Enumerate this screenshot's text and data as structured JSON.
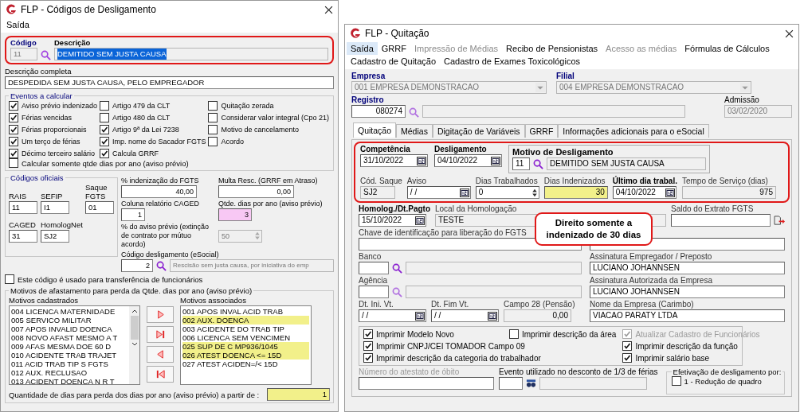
{
  "left_window": {
    "title": "FLP - Códigos de Desligamento",
    "menu": [
      {
        "label": "Saída"
      }
    ],
    "codigo": {
      "label": "Código",
      "value": "11"
    },
    "descricao": {
      "label": "Descrição",
      "value": "DEMITIDO SEM JUSTA CAUSA",
      "selected": true
    },
    "descricao_completa": {
      "label": "Descrição completa",
      "value": "DESPEDIDA SEM JUSTA CAUSA, PELO EMPREGADOR"
    },
    "eventos": {
      "title": "Eventos a calcular",
      "columns": [
        [
          {
            "label": "Aviso prévio indenizado",
            "checked": true
          },
          {
            "label": "Férias vencidas",
            "checked": true
          },
          {
            "label": "Férias proporcionais",
            "checked": true
          },
          {
            "label": "Um terço de férias",
            "checked": true
          },
          {
            "label": "Décimo terceiro salário",
            "checked": true
          }
        ],
        [
          {
            "label": "Artigo 479 da CLT",
            "checked": false
          },
          {
            "label": "Artigo 480 da CLT",
            "checked": false
          },
          {
            "label": "Artigo 9ª da Lei 7238",
            "checked": true
          },
          {
            "label": "Imp. nome do Sacador FGTS",
            "checked": true
          },
          {
            "label": "Calcula GRRF",
            "checked": true
          }
        ],
        [
          {
            "label": "Quitação zerada",
            "checked": false
          },
          {
            "label": "Considerar valor integral (Cpo 21)",
            "checked": false
          },
          {
            "label": "Motivo de cancelamento",
            "checked": false
          },
          {
            "label": "Acordo",
            "checked": false
          }
        ]
      ],
      "last": {
        "label": "Calcular somente qtde dias por ano (aviso prévio)",
        "checked": false
      }
    },
    "codigos_oficiais": {
      "title": "Códigos oficiais",
      "fields": [
        {
          "label": "RAIS",
          "value": "11"
        },
        {
          "label": "SEFIP",
          "value": "I1"
        },
        {
          "label": "Saque FGTS",
          "value": "01"
        },
        {
          "label": "CAGED",
          "value": "31"
        },
        {
          "label": "HomologNet",
          "value": "SJ2"
        }
      ]
    },
    "indenizacao_fgts": {
      "label": "% indenização do FGTS",
      "value": "40,00"
    },
    "multa_resc": {
      "label": "Multa Resc. (GRRF em Atraso)",
      "value": "0,00"
    },
    "coluna_caged": {
      "label": "Coluna relatório CAGED",
      "value": "1"
    },
    "qtde_dias": {
      "label": "Qtde. dias por ano (aviso prévio)",
      "value": "3",
      "highlighted": true
    },
    "aviso_previo_pct": {
      "label": "% do aviso prévio (extinção de contrato por mútuo acordo)",
      "value": "50",
      "disabled": true
    },
    "codigo_esocial": {
      "label": "Código desligamento (eSocial)",
      "value": "2",
      "description": "Rescisão sem justa causa, por iniciativa do emp"
    },
    "transferencia": {
      "label": "Este código é usado para transferência de funcionários",
      "checked": false
    },
    "motivos": {
      "title": "Motivos de afastamento para perda da Qtde. dias por ano (aviso prévio)",
      "cadastrados": {
        "label": "Motivos cadastrados",
        "items": [
          "004 LICENCA MATERNIDADE",
          "005 SERVICO MILITAR",
          "007 APOS INVALID DOENCA",
          "008 NOVO AFAST MESMO A T",
          "009 AFAS MESMA DOE 60  D",
          "010 ACIDENTE TRAB TRAJET",
          "011 ACID TRAB TIP S FGTS",
          "012 AUX. RECLUSAO",
          "013 ACIDENT DOENCA N R T"
        ]
      },
      "associados": {
        "label": "Motivos associados",
        "items": [
          {
            "text": "001 APOS INVAL ACID TRAB",
            "highlighted": false
          },
          {
            "text": "002 AUX. DOENCA",
            "highlighted": true
          },
          {
            "text": "003 ACIDENTE DO TRAB TIP",
            "highlighted": false
          },
          {
            "text": "006 LICENCA SEM VENCIMEN",
            "highlighted": false
          },
          {
            "text": "025 SUP DE C MP936/1045",
            "highlighted": true
          },
          {
            "text": "026 ATEST DOENCA <= 15D",
            "highlighted": true
          },
          {
            "text": "027 ATEST ACIDEN=/< 15D",
            "highlighted": false
          }
        ]
      },
      "quantidade": {
        "label": "Quantidade de dias para perda dos dias por ano (aviso prévio) a  partir de :",
        "value": "1",
        "highlighted": true
      }
    }
  },
  "right_window": {
    "title": "FLP - Quitação",
    "menu": [
      {
        "label": "Saída",
        "selected": true,
        "disabled": false
      },
      {
        "label": "GRRF",
        "selected": false,
        "disabled": false
      },
      {
        "label": "Impressão de Médias",
        "selected": false,
        "disabled": true
      },
      {
        "label": "Recibo de Pensionistas",
        "selected": false,
        "disabled": false
      },
      {
        "label": "Acesso as médias",
        "selected": false,
        "disabled": true
      },
      {
        "label": "Fórmulas de Cálculos",
        "selected": false,
        "disabled": false
      },
      {
        "label": "Cadastro de Quitação",
        "selected": false,
        "disabled": false
      },
      {
        "label": "Cadastro de Exames Toxicológicos",
        "selected": false,
        "disabled": false
      }
    ],
    "empresa": {
      "label": "Empresa",
      "value": "001 EMPRESA DEMONSTRACAO"
    },
    "filial": {
      "label": "Filial",
      "value": "004 EMPRESA DEMONSTRACAO"
    },
    "registro": {
      "label": "Registro",
      "value": "080274"
    },
    "admissao": {
      "label": "Admissão",
      "value": "03/02/2020"
    },
    "tabs": [
      {
        "label": "Quitação",
        "selected": true
      },
      {
        "label": "Médias",
        "selected": false
      },
      {
        "label": "Digitação de Variáveis",
        "selected": false
      },
      {
        "label": "GRRF",
        "selected": false
      },
      {
        "label": "Informações adicionais para o eSocial",
        "selected": false
      }
    ],
    "competencia": {
      "label": "Competência",
      "value": "31/10/2022"
    },
    "desligamento": {
      "label": "Desligamento",
      "value": "04/10/2022"
    },
    "motivo": {
      "label": "Motivo de Desligamento",
      "code": "11",
      "value": "DEMITIDO SEM JUSTA CAUSA"
    },
    "cod_saque": {
      "label": "Cód. Saque",
      "value": "SJ2"
    },
    "aviso": {
      "label": "Aviso",
      "value": "/ /"
    },
    "dias_trabalhados": {
      "label": "Dias Trabalhados",
      "value": "0"
    },
    "dias_indenizados": {
      "label": "Dias Indenizados",
      "value": "30",
      "highlighted": true
    },
    "ultimo_dia": {
      "label": "Último dia trabal.",
      "value": "04/10/2022"
    },
    "tempo_servico": {
      "label": "Tempo de Serviço (dias)",
      "value": "975"
    },
    "homolog": {
      "label": "Homolog./Dt.Pagto",
      "value": "15/10/2022"
    },
    "local": {
      "label": "Local da Homologação",
      "value": "TESTE"
    },
    "saldo": {
      "label": "Saldo do Extrato FGTS"
    },
    "chave": {
      "label": "Chave de identificação para liberação do FGTS"
    },
    "banco": {
      "label": "Banco"
    },
    "agencia": {
      "label": "Agência"
    },
    "assin_empregador": {
      "label": "Assinatura Empregador / Preposto",
      "value": "LUCIANO JOHANNSEN"
    },
    "assin_autorizada": {
      "label": "Assinatura Autorizada da Empresa",
      "value": "LUCIANO JOHANNSEN"
    },
    "dt_ini": {
      "label": "Dt. Ini. Vt.",
      "value": "/ /"
    },
    "dt_fim": {
      "label": "Dt. Fim Vt.",
      "value": "/ /"
    },
    "campo28": {
      "label": "Campo 28 (Pensão)",
      "value": "0,00"
    },
    "nome_empresa": {
      "label": "Nome da Empresa (Carimbo)",
      "value": "VIACAO PARATY LTDA"
    },
    "opcoes": [
      [
        {
          "label": "Imprimir Modelo Novo",
          "checked": true,
          "disabled": false
        },
        {
          "label": "Imprimir CNPJ/CEI TOMADOR Campo 09",
          "checked": true,
          "disabled": false
        },
        {
          "label": "Imprimir descrição da categoria do trabalhador",
          "checked": true,
          "disabled": false
        }
      ],
      [
        {
          "label": "Imprimir descrição da área",
          "checked": false,
          "disabled": false
        }
      ],
      [
        {
          "label": "Atualizar Cadastro de Funcionários",
          "checked": true,
          "disabled": true
        },
        {
          "label": "Imprimir descrição da função",
          "checked": true,
          "disabled": false
        },
        {
          "label": "Imprimir salário base",
          "checked": true,
          "disabled": false
        }
      ]
    ],
    "atestado": {
      "label": "Número do atestato de óbito",
      "disabled": true
    },
    "evento": {
      "label": "Evento utilizado no desconto de 1/3 de férias"
    },
    "efetivacao": {
      "title": "Efetivação de desligamento por:",
      "options": [
        {
          "label": "1 - Redução de quadro",
          "checked": false
        }
      ]
    },
    "callout": {
      "text": "Direito somente a indenizado de 30 dias"
    }
  }
}
